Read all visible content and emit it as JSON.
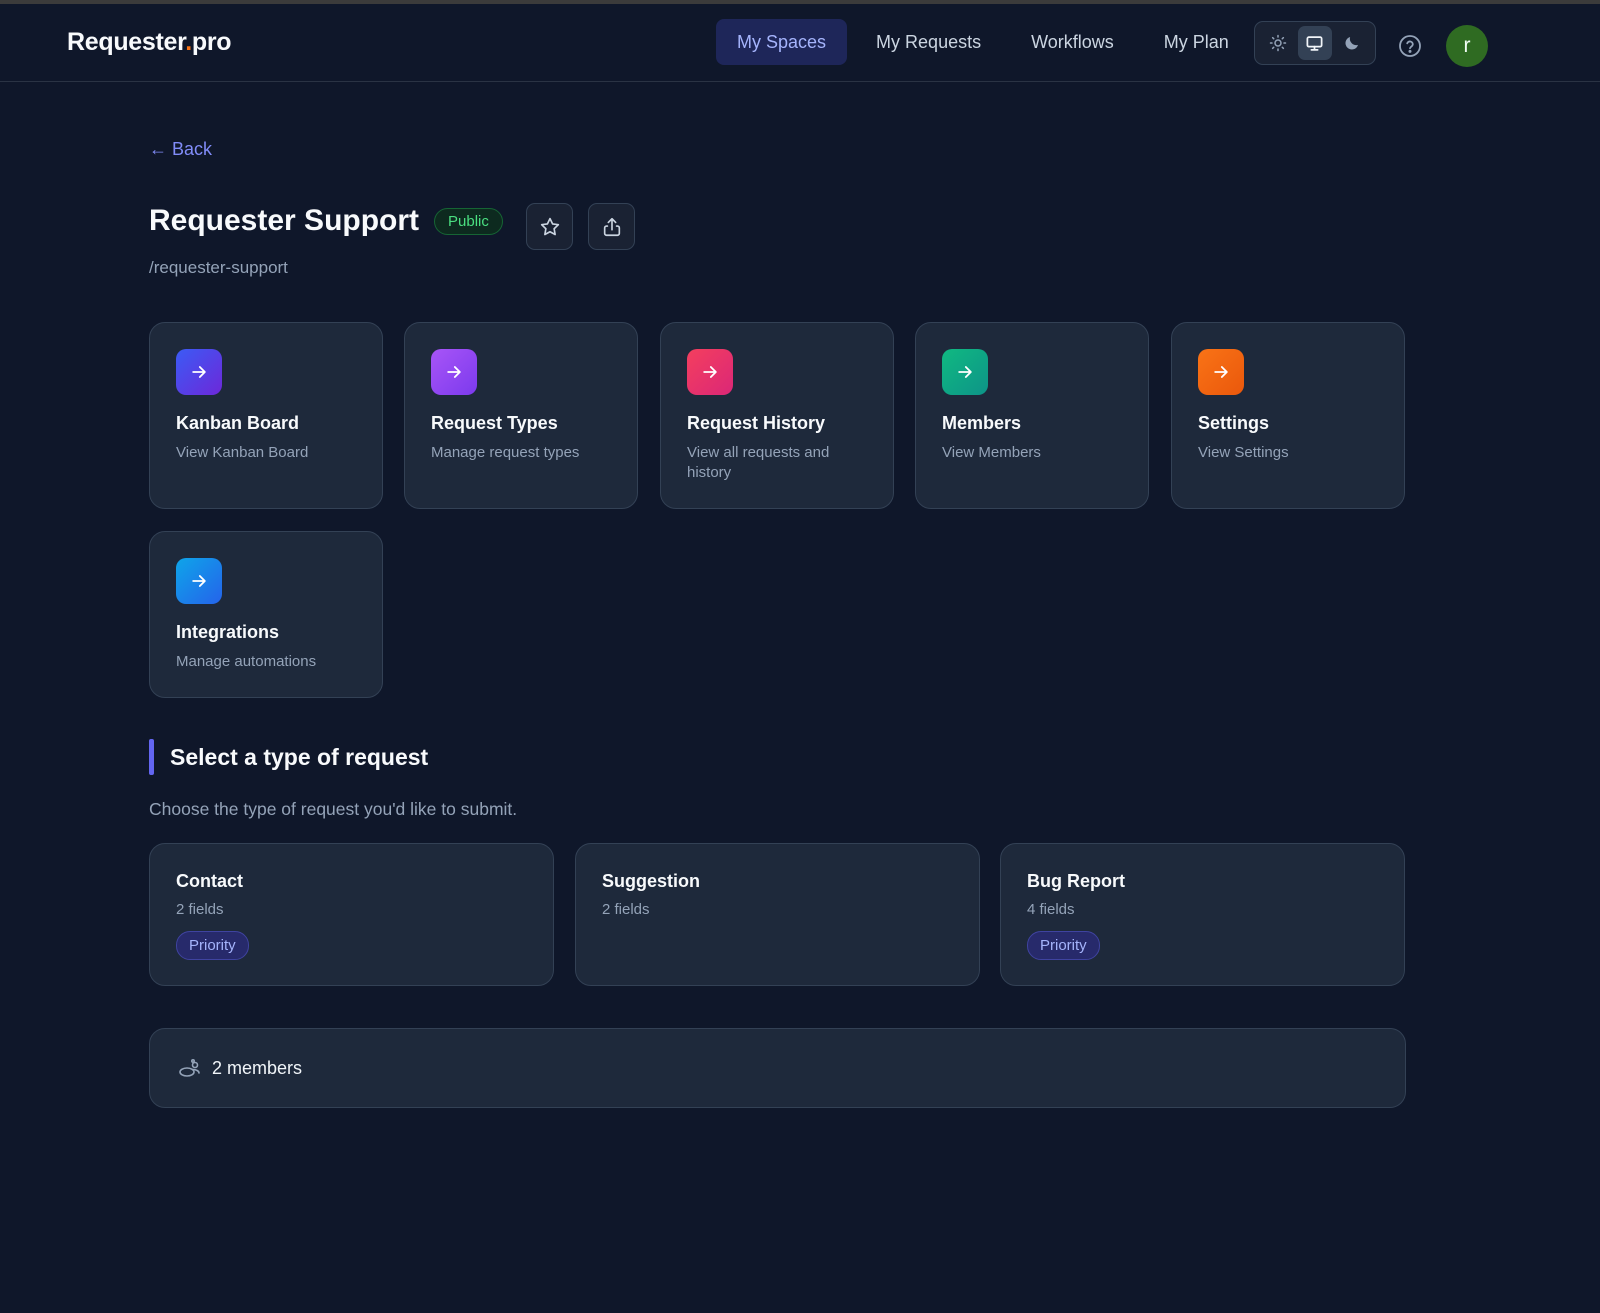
{
  "app": {
    "logo_main": "Requester",
    "logo_dot": ".",
    "logo_tld": "pro"
  },
  "nav": {
    "items": [
      {
        "label": "My Spaces",
        "active": true
      },
      {
        "label": "My Requests",
        "active": false
      },
      {
        "label": "Workflows",
        "active": false
      },
      {
        "label": "My Plan",
        "active": false
      }
    ]
  },
  "theme": {
    "options": [
      "light",
      "system",
      "dark"
    ],
    "selected": "system"
  },
  "user": {
    "initial": "r",
    "avatar_color": "#2f6b22"
  },
  "page": {
    "back_label": "← Back",
    "title": "Requester Support",
    "visibility": "Public",
    "slug": "/requester-support"
  },
  "cards": [
    {
      "title": "Kanban Board",
      "desc": "View Kanban Board",
      "icon": "arrow-right-icon",
      "from": "#3b5bf5",
      "to": "#6d28d9"
    },
    {
      "title": "Request Types",
      "desc": "Manage request types",
      "icon": "arrow-right-icon",
      "from": "#a855f7",
      "to": "#7c3aed"
    },
    {
      "title": "Request History",
      "desc": "View all requests and history",
      "icon": "arrow-right-icon",
      "from": "#f43f5e",
      "to": "#db2777"
    },
    {
      "title": "Members",
      "desc": "View Members",
      "icon": "arrow-right-icon",
      "from": "#10b981",
      "to": "#0d9488"
    },
    {
      "title": "Settings",
      "desc": "View Settings",
      "icon": "arrow-right-icon",
      "from": "#f97316",
      "to": "#ea580c"
    },
    {
      "title": "Integrations",
      "desc": "Manage automations",
      "icon": "arrow-right-icon",
      "from": "#0ea5e9",
      "to": "#2563eb"
    }
  ],
  "section": {
    "title": "Select a type of request",
    "desc": "Choose the type of request you'd like to submit."
  },
  "request_types": [
    {
      "name": "Contact",
      "fields": "2 fields",
      "tag": "Priority"
    },
    {
      "name": "Suggestion",
      "fields": "2 fields",
      "tag": ""
    },
    {
      "name": "Bug Report",
      "fields": "4 fields",
      "tag": "Priority"
    }
  ],
  "members": {
    "label": "2 members"
  }
}
